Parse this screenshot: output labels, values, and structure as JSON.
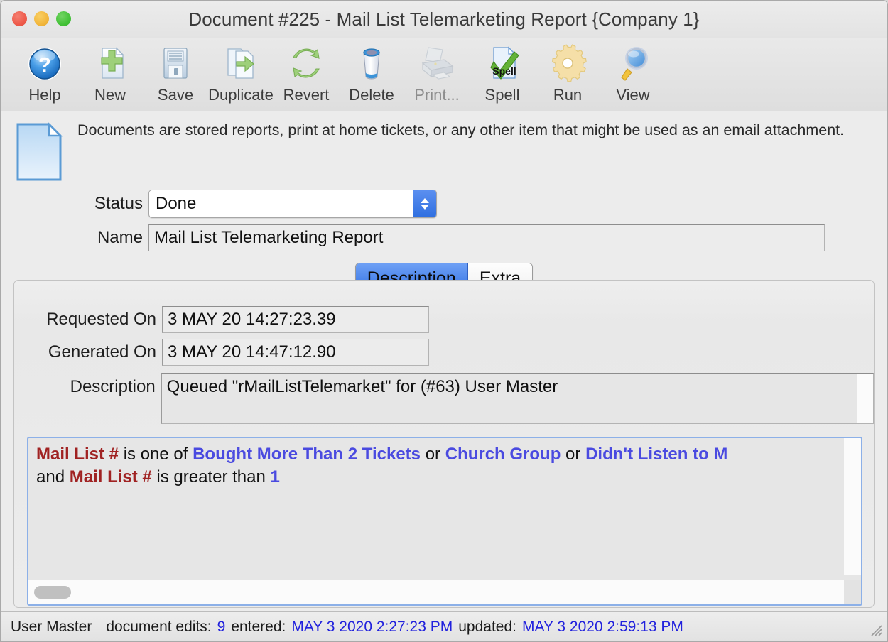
{
  "window": {
    "title": "Document #225 - Mail List Telemarketing Report {Company 1}"
  },
  "toolbar": {
    "items": [
      {
        "label": "Help",
        "icon": "help-icon",
        "enabled": true
      },
      {
        "label": "New",
        "icon": "new-document-icon",
        "enabled": true
      },
      {
        "label": "Save",
        "icon": "save-floppy-icon",
        "enabled": true
      },
      {
        "label": "Duplicate",
        "icon": "duplicate-icon",
        "enabled": true
      },
      {
        "label": "Revert",
        "icon": "revert-refresh-icon",
        "enabled": true
      },
      {
        "label": "Delete",
        "icon": "delete-trash-icon",
        "enabled": true
      },
      {
        "label": "Print...",
        "icon": "printer-icon",
        "enabled": false
      },
      {
        "label": "Spell",
        "icon": "spell-check-icon",
        "enabled": true
      },
      {
        "label": "Run",
        "icon": "run-gear-icon",
        "enabled": true
      },
      {
        "label": "View",
        "icon": "view-magnifier-icon",
        "enabled": true
      }
    ]
  },
  "intro": {
    "icon": "document-icon",
    "text": "Documents are stored reports, print at home tickets, or any other item that might be used as an email attachment."
  },
  "form": {
    "status_label": "Status",
    "status_value": "Done",
    "name_label": "Name",
    "name_value": "Mail List Telemarketing Report"
  },
  "tabs": [
    {
      "label": "Description",
      "active": true
    },
    {
      "label": "Extra",
      "active": false
    }
  ],
  "description_panel": {
    "requested_label": "Requested On",
    "requested_value": "3 MAY 20  14:27:23.39",
    "generated_label": "Generated On",
    "generated_value": "3 MAY 20  14:47:12.90",
    "description_label": "Description",
    "description_value": "Queued \"rMailListTelemarket\" for (#63) User Master"
  },
  "criteria": {
    "line1": [
      {
        "t": "Mail List #",
        "k": "field"
      },
      {
        "t": " is one of ",
        "k": "plain"
      },
      {
        "t": "Bought More Than 2 Tickets",
        "k": "value"
      },
      {
        "t": " or ",
        "k": "plain"
      },
      {
        "t": "Church Group",
        "k": "value"
      },
      {
        "t": " or ",
        "k": "plain"
      },
      {
        "t": "Didn't Listen to M",
        "k": "value"
      }
    ],
    "line2": [
      {
        "t": "and ",
        "k": "plain"
      },
      {
        "t": "Mail List #",
        "k": "field"
      },
      {
        "t": " is greater than ",
        "k": "plain"
      },
      {
        "t": "1",
        "k": "value"
      }
    ]
  },
  "statusbar": {
    "user": "User Master",
    "edits_label": "document edits:",
    "edits_count": "9",
    "entered_label": "entered:",
    "entered_value": "MAY 3 2020 2:27:23 PM",
    "updated_label": "updated:",
    "updated_value": "MAY 3 2020 2:59:13 PM"
  },
  "colors": {
    "accent_blue": "#2f6fe2",
    "field_red": "#a02222",
    "value_blue": "#4a4ae0",
    "status_blue": "#2222dd"
  }
}
